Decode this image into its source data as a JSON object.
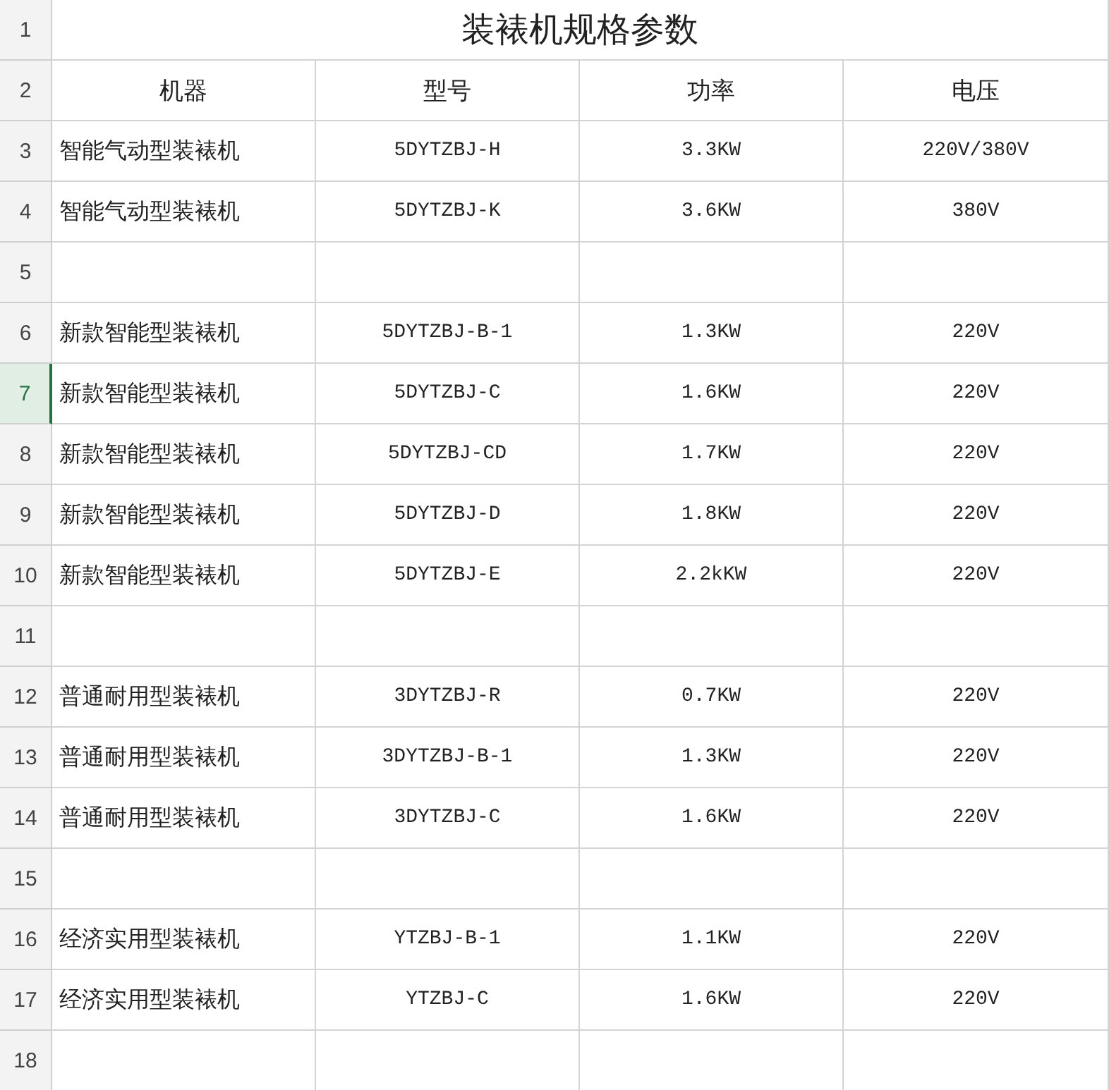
{
  "sheet": {
    "rows": [
      {
        "kind": "title",
        "number": "1",
        "selected": false,
        "title": "装裱机规格参数"
      },
      {
        "kind": "header",
        "number": "2",
        "selected": false,
        "cells": [
          "机器",
          "型号",
          "功率",
          "电压"
        ]
      },
      {
        "kind": "data",
        "number": "3",
        "selected": false,
        "cells": [
          "智能气动型装裱机",
          "5DYTZBJ-H",
          "3.3KW",
          "220V/380V"
        ]
      },
      {
        "kind": "data",
        "number": "4",
        "selected": false,
        "cells": [
          "智能气动型装裱机",
          "5DYTZBJ-K",
          "3.6KW",
          "380V"
        ]
      },
      {
        "kind": "blank",
        "number": "5",
        "selected": false
      },
      {
        "kind": "data",
        "number": "6",
        "selected": false,
        "cells": [
          "新款智能型装裱机",
          "5DYTZBJ-B-1",
          "1.3KW",
          "220V"
        ]
      },
      {
        "kind": "data",
        "number": "7",
        "selected": true,
        "cells": [
          "新款智能型装裱机",
          "5DYTZBJ-C",
          "1.6KW",
          "220V"
        ]
      },
      {
        "kind": "data",
        "number": "8",
        "selected": false,
        "cells": [
          "新款智能型装裱机",
          "5DYTZBJ-CD",
          "1.7KW",
          "220V"
        ]
      },
      {
        "kind": "data",
        "number": "9",
        "selected": false,
        "cells": [
          "新款智能型装裱机",
          "5DYTZBJ-D",
          "1.8KW",
          "220V"
        ]
      },
      {
        "kind": "data",
        "number": "10",
        "selected": false,
        "cells": [
          "新款智能型装裱机",
          "5DYTZBJ-E",
          "2.2kKW",
          "220V"
        ]
      },
      {
        "kind": "blank",
        "number": "11",
        "selected": false
      },
      {
        "kind": "data",
        "number": "12",
        "selected": false,
        "cells": [
          "普通耐用型装裱机",
          "3DYTZBJ-R",
          "0.7KW",
          "220V"
        ]
      },
      {
        "kind": "data",
        "number": "13",
        "selected": false,
        "cells": [
          "普通耐用型装裱机",
          "3DYTZBJ-B-1",
          "1.3KW",
          "220V"
        ]
      },
      {
        "kind": "data",
        "number": "14",
        "selected": false,
        "cells": [
          "普通耐用型装裱机",
          "3DYTZBJ-C",
          "1.6KW",
          "220V"
        ]
      },
      {
        "kind": "blank",
        "number": "15",
        "selected": false
      },
      {
        "kind": "data",
        "number": "16",
        "selected": false,
        "cells": [
          "经济实用型装裱机",
          "YTZBJ-B-1",
          "1.1KW",
          "220V"
        ]
      },
      {
        "kind": "data",
        "number": "17",
        "selected": false,
        "cells": [
          "经济实用型装裱机",
          "YTZBJ-C",
          "1.6KW",
          "220V"
        ]
      },
      {
        "kind": "blank",
        "number": "18",
        "selected": false
      }
    ]
  }
}
